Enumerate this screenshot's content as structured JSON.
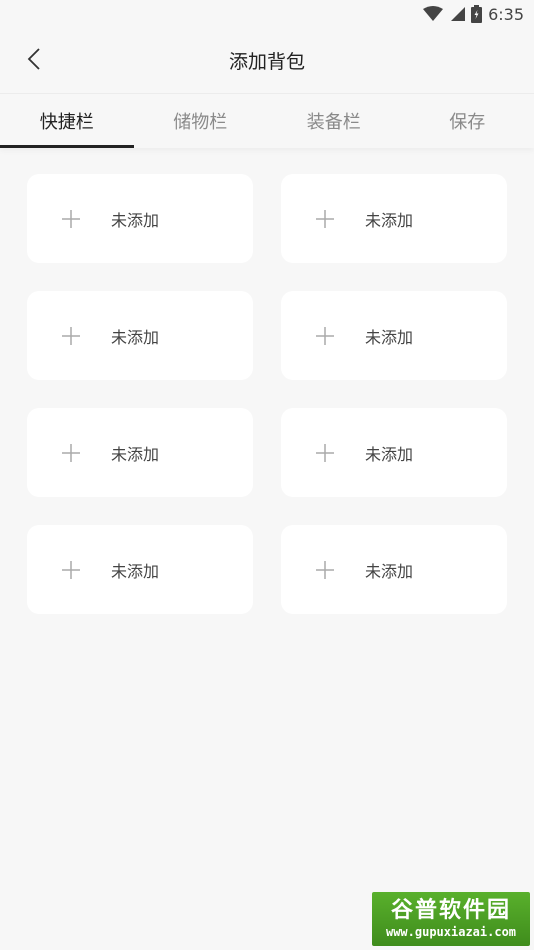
{
  "status_bar": {
    "time": "6:35",
    "icons": [
      "wifi-icon",
      "signal-icon",
      "battery-icon"
    ]
  },
  "appbar": {
    "title": "添加背包",
    "back_icon": "chevron-left-icon"
  },
  "tabs": [
    {
      "label": "快捷栏",
      "active": true
    },
    {
      "label": "储物栏",
      "active": false
    },
    {
      "label": "装备栏",
      "active": false
    },
    {
      "label": "保存",
      "active": false
    }
  ],
  "slots": [
    {
      "label": "未添加",
      "icon": "plus-icon"
    },
    {
      "label": "未添加",
      "icon": "plus-icon"
    },
    {
      "label": "未添加",
      "icon": "plus-icon"
    },
    {
      "label": "未添加",
      "icon": "plus-icon"
    },
    {
      "label": "未添加",
      "icon": "plus-icon"
    },
    {
      "label": "未添加",
      "icon": "plus-icon"
    },
    {
      "label": "未添加",
      "icon": "plus-icon"
    },
    {
      "label": "未添加",
      "icon": "plus-icon"
    }
  ],
  "watermark": {
    "title": "谷普软件园",
    "url": "www.gupuxiazai.com"
  },
  "colors": {
    "background": "#f7f7f7",
    "card": "#ffffff",
    "active_tab": "#222222",
    "inactive_tab": "#8a8a8a",
    "watermark": "#4e9f24"
  }
}
